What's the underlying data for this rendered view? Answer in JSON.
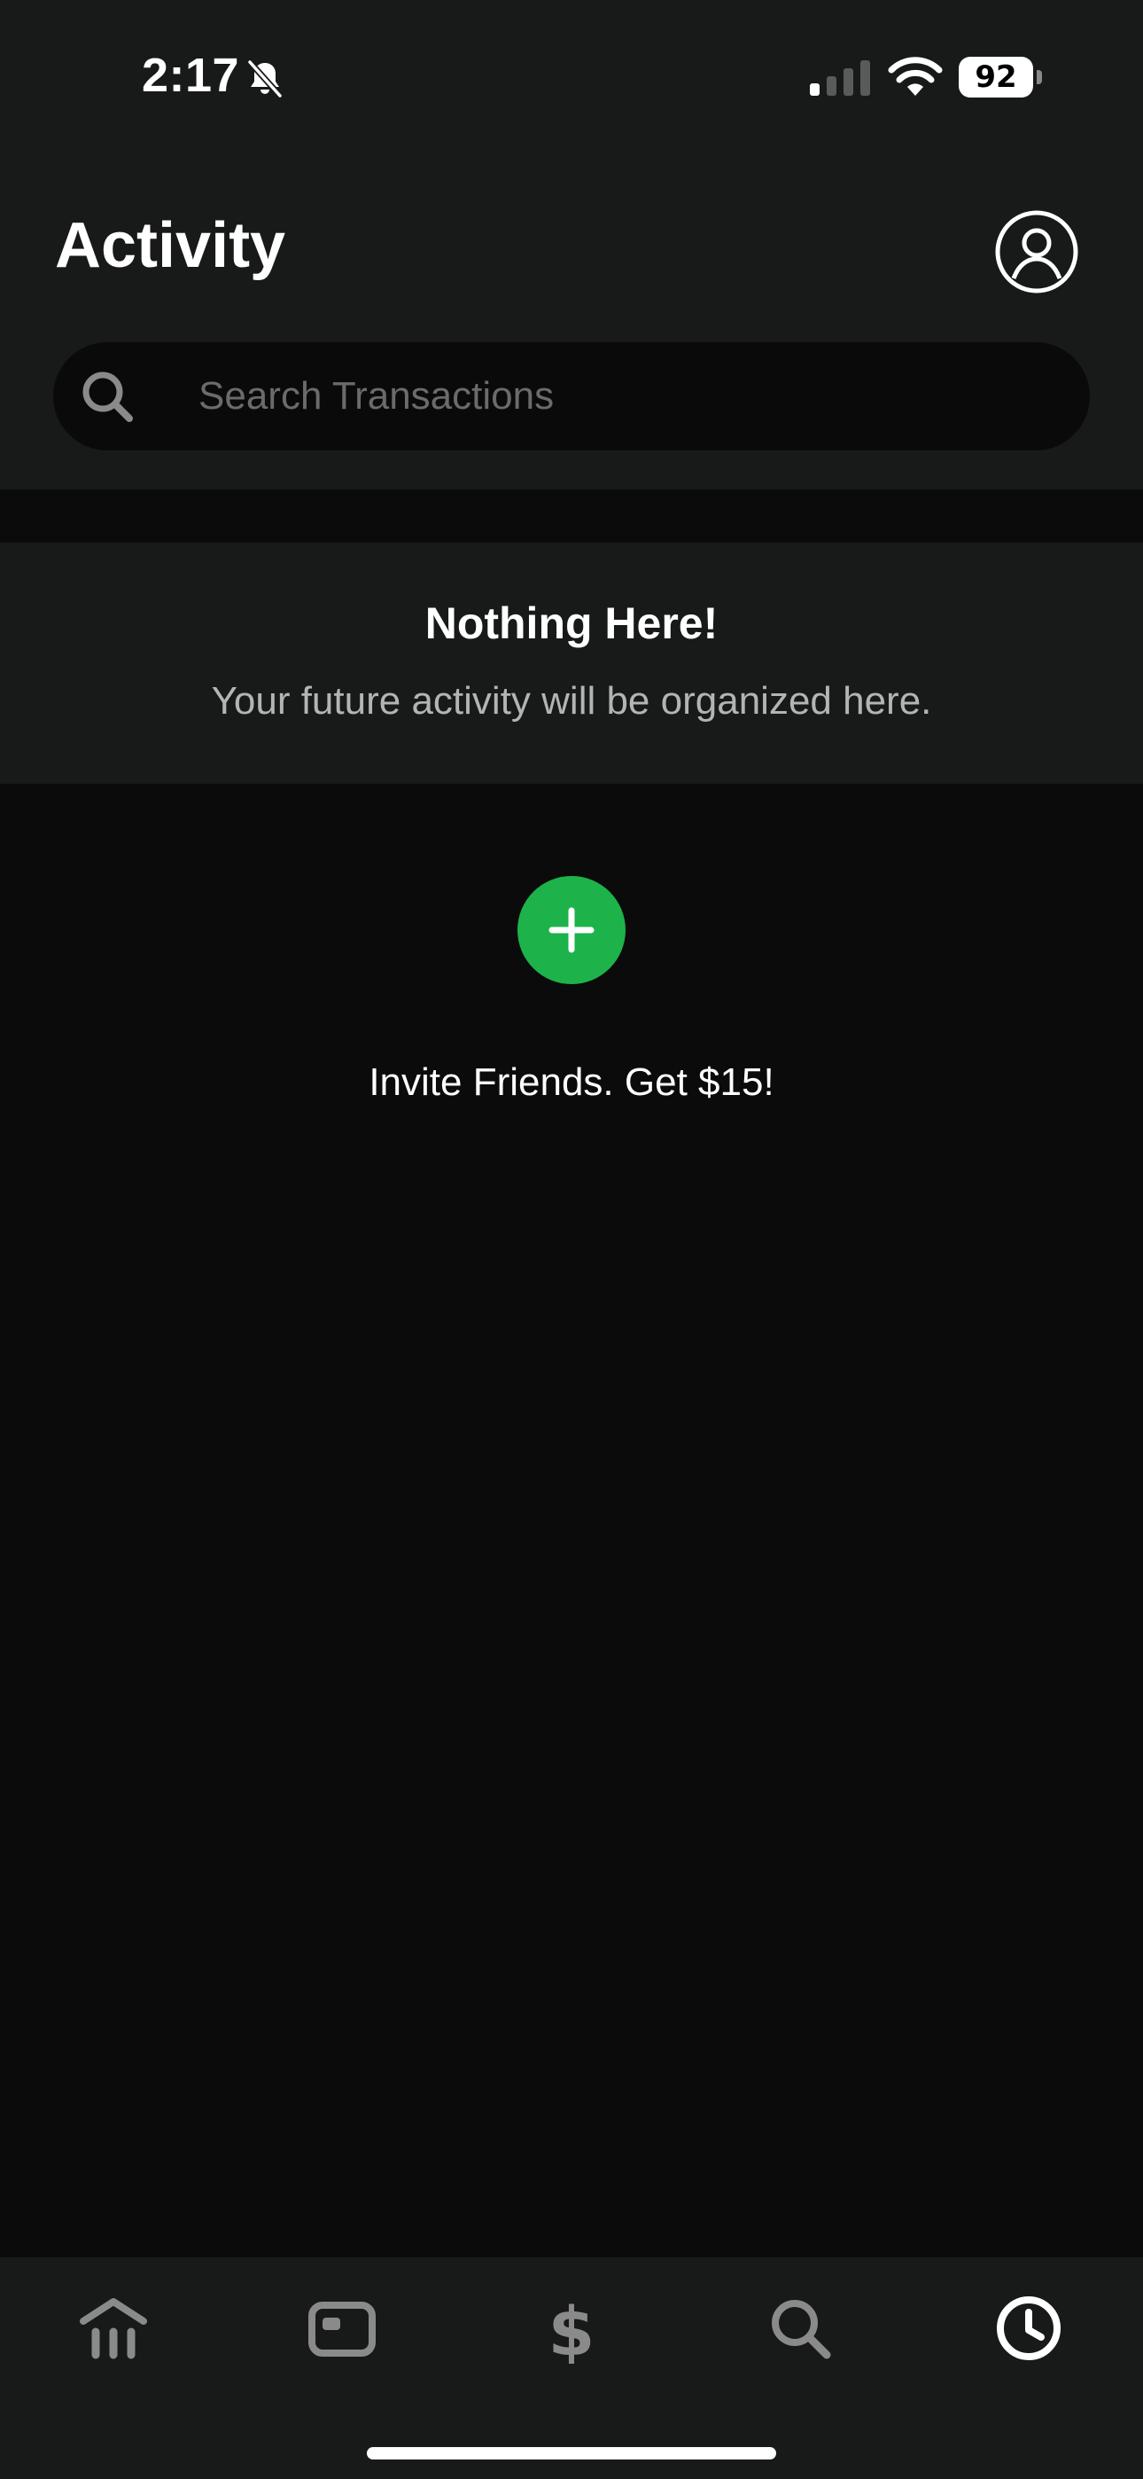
{
  "status_bar": {
    "time": "2:17",
    "battery": "92",
    "icons": [
      "bell-slash-icon",
      "signal-icon",
      "wifi-icon",
      "battery-icon"
    ]
  },
  "header": {
    "title": "Activity",
    "profile_icon": "person-circle-icon"
  },
  "search": {
    "placeholder": "Search Transactions",
    "value": "",
    "icon": "search-icon"
  },
  "empty_state": {
    "title": "Nothing Here!",
    "subtitle": "Your future activity will be organized here."
  },
  "invite": {
    "icon": "plus-icon",
    "label": "Invite Friends. Get $15!"
  },
  "tab_bar": {
    "tabs": [
      {
        "icon": "bank-icon",
        "active": false
      },
      {
        "icon": "card-icon",
        "active": false
      },
      {
        "icon": "dollar-icon",
        "active": false
      },
      {
        "icon": "search-icon",
        "active": false
      },
      {
        "icon": "clock-icon",
        "active": true
      }
    ]
  },
  "colors": {
    "background": "#0b0b0b",
    "surface": "#181a1a",
    "accent_green": "#1db34a",
    "inactive_icon": "#8a8a8a",
    "active_icon": "#ffffff"
  }
}
